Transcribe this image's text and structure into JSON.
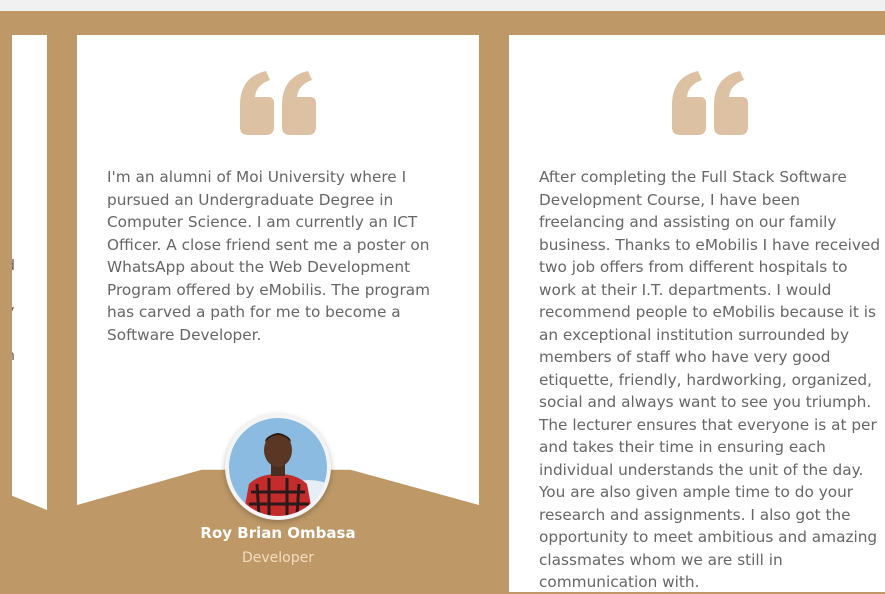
{
  "colors": {
    "accent": "#be9867",
    "quote": "#dcc2a2",
    "text": "#666666",
    "role": "#f3dcc0"
  },
  "icons": {
    "quote": "quote-icon",
    "avatar": "avatar-photo"
  },
  "left_fragment": {
    "lines": [
      "d",
      "y",
      "n"
    ]
  },
  "testimonials": [
    {
      "text": "I'm an alumni of Moi University where I pursued an Undergraduate Degree in Computer Science. I am currently an ICT Officer. A close friend sent me a poster on WhatsApp about the Web Development Program offered by eMobilis. The program has carved a path for me to become a Software Developer.",
      "name": "Roy Brian Ombasa",
      "role": "Developer"
    },
    {
      "text": "After completing the Full Stack Software Development Course, I have been freelancing and assisting on our family business. Thanks to eMobilis I have received two job offers from different hospitals to work at their I.T. departments. I would recommend people to eMobilis because it is an exceptional institution surrounded by members of staff who have very good etiquette, friendly, hardworking, organized, social and always want to see you triumph. The lecturer ensures that everyone is at per and takes their time in ensuring each individual understands the unit of the day. You are also given ample time to do your research and assignments. I also got the opportunity to meet ambitious and amazing classmates whom we are still in communication with."
    }
  ]
}
